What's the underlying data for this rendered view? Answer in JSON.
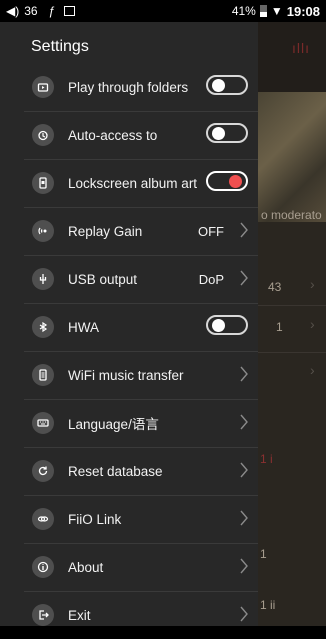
{
  "status": {
    "volume": "36",
    "battery": "41%",
    "time": "19:08"
  },
  "drawer": {
    "title": "Settings"
  },
  "items": [
    {
      "label": "Play through folders",
      "control": "toggle",
      "on": false,
      "icon": "folder-play-icon"
    },
    {
      "label": "Auto-access to",
      "control": "toggle",
      "on": false,
      "icon": "timer-icon"
    },
    {
      "label": "Lockscreen album art",
      "control": "toggle",
      "on": true,
      "icon": "phone-image-icon"
    },
    {
      "label": "Replay Gain",
      "value": "OFF",
      "control": "chevron",
      "icon": "sound-wave-icon"
    },
    {
      "label": "USB output",
      "value": "DoP",
      "control": "chevron",
      "icon": "usb-icon"
    },
    {
      "label": "HWA",
      "control": "toggle",
      "on": false,
      "icon": "bluetooth-audio-icon"
    },
    {
      "label": "WiFi music transfer",
      "control": "chevron",
      "icon": "wifi-transfer-icon"
    },
    {
      "label": "Language/语言",
      "control": "chevron",
      "icon": "keyboard-icon"
    },
    {
      "label": "Reset database",
      "control": "chevron",
      "icon": "refresh-icon"
    },
    {
      "label": "FiiO Link",
      "control": "chevron",
      "icon": "link-icon"
    },
    {
      "label": "About",
      "control": "chevron",
      "icon": "info-icon"
    },
    {
      "label": "Exit",
      "control": "chevron",
      "icon": "exit-icon"
    }
  ],
  "background": {
    "text1": "o moderato",
    "num1": "43",
    "num2": "1",
    "txt3": "1 i",
    "txt4": "1",
    "txt5": "1 ii"
  }
}
